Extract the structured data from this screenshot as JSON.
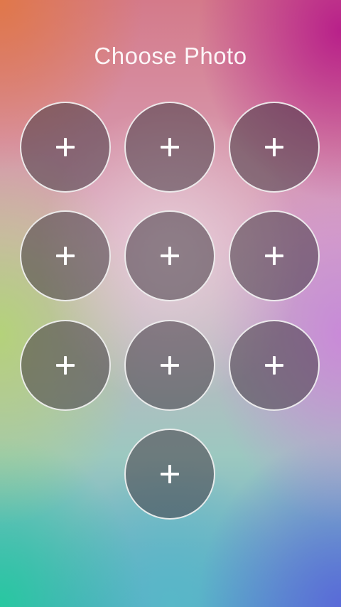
{
  "screen": {
    "title": "Choose Photo"
  },
  "photo_slots": [
    {
      "icon": "plus-icon"
    },
    {
      "icon": "plus-icon"
    },
    {
      "icon": "plus-icon"
    },
    {
      "icon": "plus-icon"
    },
    {
      "icon": "plus-icon"
    },
    {
      "icon": "plus-icon"
    },
    {
      "icon": "plus-icon"
    },
    {
      "icon": "plus-icon"
    },
    {
      "icon": "plus-icon"
    },
    {
      "icon": "plus-icon"
    }
  ],
  "colors": {
    "title": "#ffffff",
    "slot_border": "#ffffff",
    "slot_fill": "#463c46"
  }
}
